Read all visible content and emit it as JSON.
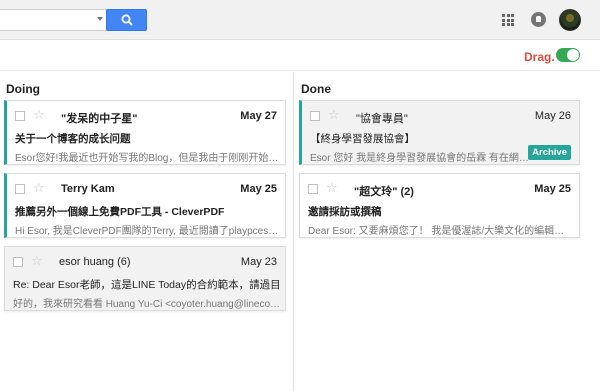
{
  "topbar": {
    "search_placeholder": "",
    "search_icon": "search-icon",
    "apps_icon": "apps-grid-icon",
    "notifications_icon": "notifications-icon",
    "avatar_icon": "user-avatar"
  },
  "drag": {
    "label": "Drag.",
    "toggle_on": true,
    "toggle_color": "#34a853",
    "label_color": "#dd4b39"
  },
  "accent_color": "#26a69a",
  "columns": {
    "doing": {
      "title": "Doing",
      "cards": [
        {
          "sender": "\"发呆的中子星\"",
          "date": "May 27",
          "subject": "关于一个博客的成长问题",
          "snippet": "Esor您好!我最近也开始写我的Blog，但是我由于刚刚开始写，所..."
        },
        {
          "sender": "Terry Kam",
          "date": "May 25",
          "subject": "推薦另外一個線上免費PDF工具 - CleverPDF",
          "snippet": "Hi Esor, 我是CleverPDF團隊的Terry, 最近閱讀了playpcesor上您..."
        },
        {
          "sender": "esor huang (6)",
          "date": "May 23",
          "subject": "Re: Dear Esor老師，這是LINE Today的合約範本，請過目唷",
          "snippet": "好的，我來研究看看 Huang Yu-Ci <coyoter.huang@linecorp.co..."
        }
      ]
    },
    "done": {
      "title": "Done",
      "cards": [
        {
          "sender": "\"協會專員\"",
          "date": "May 26",
          "subject": "【終身學習發展協會】",
          "snippet": "Esor 您好 我是終身學習發展協會的岳霖 有在網路上有",
          "action": "Archive"
        },
        {
          "sender": "\"超文玲\" (2)",
          "date": "May 25",
          "subject": "邀請採訪或撰稿",
          "snippet": "Dear Esor: 又要麻煩您了！ 我是優渥誌/大樂文化的編輯超文玲..."
        }
      ]
    }
  }
}
